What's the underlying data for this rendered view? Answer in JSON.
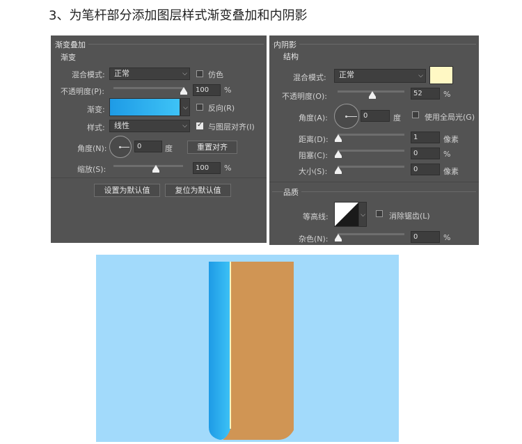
{
  "heading": "3、为笔杆部分添加图层样式渐变叠加和内阴影",
  "gradient_overlay": {
    "title": "渐变叠加",
    "section": "渐变",
    "blend_mode_label": "混合模式:",
    "blend_mode_value": "正常",
    "dither_label": "仿色",
    "opacity_label": "不透明度(P):",
    "opacity_value": "100",
    "percent": "%",
    "gradient_label": "渐变:",
    "gradient_colors": [
      "#1e9be6",
      "#3ec3f6"
    ],
    "reverse_label": "反向(R)",
    "style_label": "样式:",
    "style_value": "线性",
    "align_label": "与图层对齐(I)",
    "align_checked": true,
    "angle_label": "角度(N):",
    "angle_value": "0",
    "degree": "度",
    "reset_align_button": "重置对齐",
    "scale_label": "缩放(S):",
    "scale_value": "100",
    "make_default_button": "设置为默认值",
    "reset_default_button": "复位为默认值"
  },
  "inner_shadow": {
    "title": "内阴影",
    "section": "结构",
    "blend_mode_label": "混合模式:",
    "blend_mode_value": "正常",
    "shadow_color": "#fff8c4",
    "opacity_label": "不透明度(O):",
    "opacity_value": "52",
    "percent": "%",
    "angle_label": "角度(A):",
    "angle_value": "0",
    "degree": "度",
    "global_light_label": "使用全局光(G)",
    "distance_label": "距离(D):",
    "distance_value": "1",
    "choke_label": "阻塞(C):",
    "choke_value": "0",
    "size_label": "大小(S):",
    "size_value": "0",
    "pixels": "像素",
    "quality_section": "品质",
    "contour_label": "等高线:",
    "antialias_label": "消除锯齿(L)",
    "noise_label": "杂色(N):",
    "noise_value": "0"
  },
  "colors": {
    "panel_bg": "#535353",
    "scene_bg": "#a2dafb",
    "pen_body": "#d09554",
    "pen_highlight": "#fff6c0"
  }
}
